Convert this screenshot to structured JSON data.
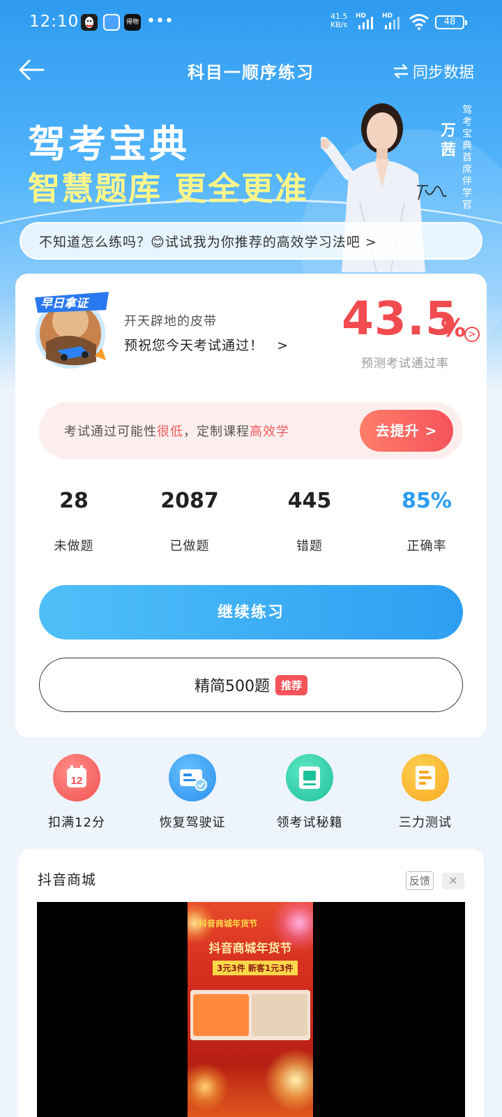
{
  "status_bar": {
    "time": "12:10",
    "apps": [
      "qq-icon",
      "chat-icon",
      "得物"
    ],
    "more": "•••",
    "net_speed_top": "41.5",
    "net_speed_bottom": "KB/s",
    "signal_label_1": "HD",
    "signal_label_2": "HD",
    "battery": "48"
  },
  "nav": {
    "back_icon": "arrow-left-icon",
    "title": "科目一顺序练习",
    "sync_label": "同步数据",
    "sync_icon": "swap-arrows-icon"
  },
  "banner": {
    "title": "驾考宝典",
    "subtitle": "智慧题库 更全更准",
    "ambassador_name": "万茜",
    "ambassador_title": "驾考宝典首席伴学官",
    "signature": "万茜"
  },
  "tip": {
    "text": "不知道怎么练吗？😊试试我为你推荐的高效学习法吧 >"
  },
  "profile": {
    "badge_text": "早日拿证",
    "nickname": "开天辟地的皮带",
    "wish": "预祝您今天考试通过！",
    "pass_rate_value": "43.5",
    "pass_rate_unit": "%",
    "pass_rate_label": "预测考试通过率"
  },
  "improve": {
    "text_prefix": "考试通过可能性",
    "text_low": "很低",
    "text_mid": "，定制课程",
    "text_efficient": "高效学",
    "button": "去提升 >"
  },
  "stats": [
    {
      "value": "28",
      "label": "未做题"
    },
    {
      "value": "2087",
      "label": "已做题"
    },
    {
      "value": "445",
      "label": "错题"
    },
    {
      "value": "85%",
      "label": "正确率"
    }
  ],
  "actions": {
    "continue": "继续练习",
    "simple_500": "精简500题",
    "recommend_tag": "推荐"
  },
  "tools": [
    {
      "label": "扣满12分",
      "icon": "calendar-12-icon"
    },
    {
      "label": "恢复驾驶证",
      "icon": "license-card-icon"
    },
    {
      "label": "领考试秘籍",
      "icon": "book-icon"
    },
    {
      "label": "三力测试",
      "icon": "test-paper-icon"
    }
  ],
  "shop": {
    "title": "抖音商城",
    "feedback": "反馈",
    "close": "✕",
    "ad": {
      "line1": "抖音商城年货节",
      "line2": "抖音商城年货节",
      "line3": "3元3件 新客1元3件"
    }
  },
  "colors": {
    "primary_blue": "#2e9ef2",
    "accent_red": "#f14b4f",
    "banner_yellow": "#fff68a"
  }
}
